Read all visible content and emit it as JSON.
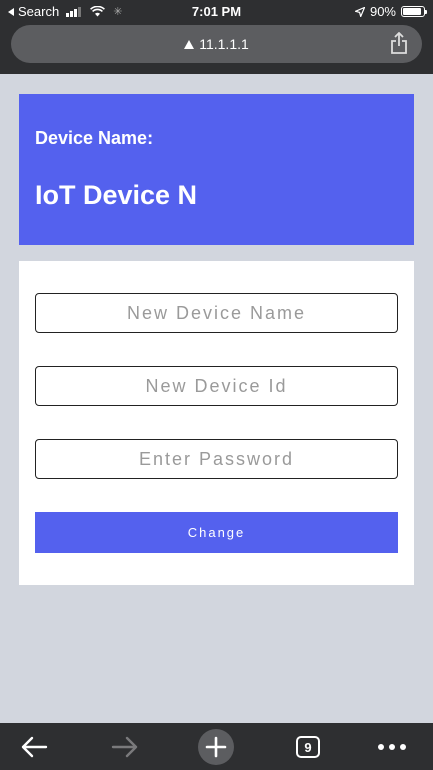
{
  "status_bar": {
    "back_app": "Search",
    "time": "7:01 PM",
    "battery": "90%",
    "battery_level": 0.9
  },
  "browser": {
    "url": "11.1.1.1"
  },
  "device": {
    "label": "Device Name:",
    "name": "IoT Device N"
  },
  "form": {
    "name_placeholder": "New Device Name",
    "id_placeholder": "New Device Id",
    "password_placeholder": "Enter Password",
    "submit_label": "Change"
  },
  "toolbar": {
    "tab_count": "9"
  },
  "colors": {
    "accent": "#5461ee",
    "chrome": "#2e2f31",
    "background": "#d2d6de"
  }
}
